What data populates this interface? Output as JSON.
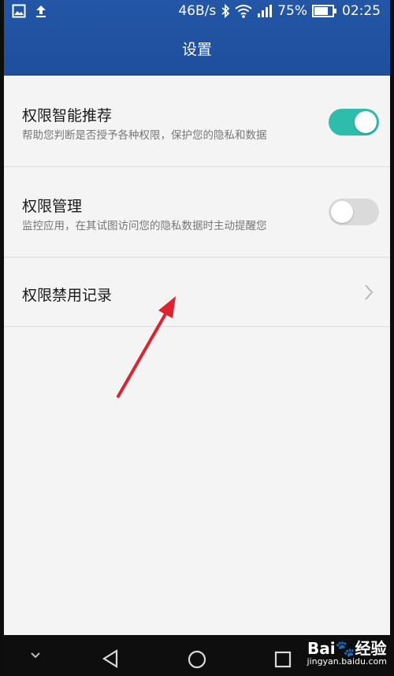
{
  "status_bar": {
    "speed": "46B/s",
    "battery": "75%",
    "time": "02:25",
    "icons": [
      "gallery-icon",
      "upload-icon",
      "bluetooth-icon",
      "wifi-icon",
      "signal-icon",
      "battery-icon"
    ]
  },
  "header": {
    "title": "设置"
  },
  "settings": [
    {
      "title": "权限智能推荐",
      "subtitle": "帮助您判断是否授予各种权限，保护您的隐私和数据",
      "toggle_on": true
    },
    {
      "title": "权限管理",
      "subtitle": "监控应用，在其试图访问您的隐私数据时主动提醒您",
      "toggle_on": false
    },
    {
      "title": "权限禁用记录"
    }
  ],
  "colors": {
    "header": "#2356a6",
    "toggle_on": "#2ebdaa",
    "toggle_off": "#dadada",
    "annotation_arrow": "#e0212e"
  },
  "watermark": {
    "logo": "Bai🐾经验",
    "url": "jingyan.baidu.com"
  },
  "nav_icons": [
    "chevron-down-icon",
    "back-icon",
    "home-icon",
    "recents-icon"
  ]
}
